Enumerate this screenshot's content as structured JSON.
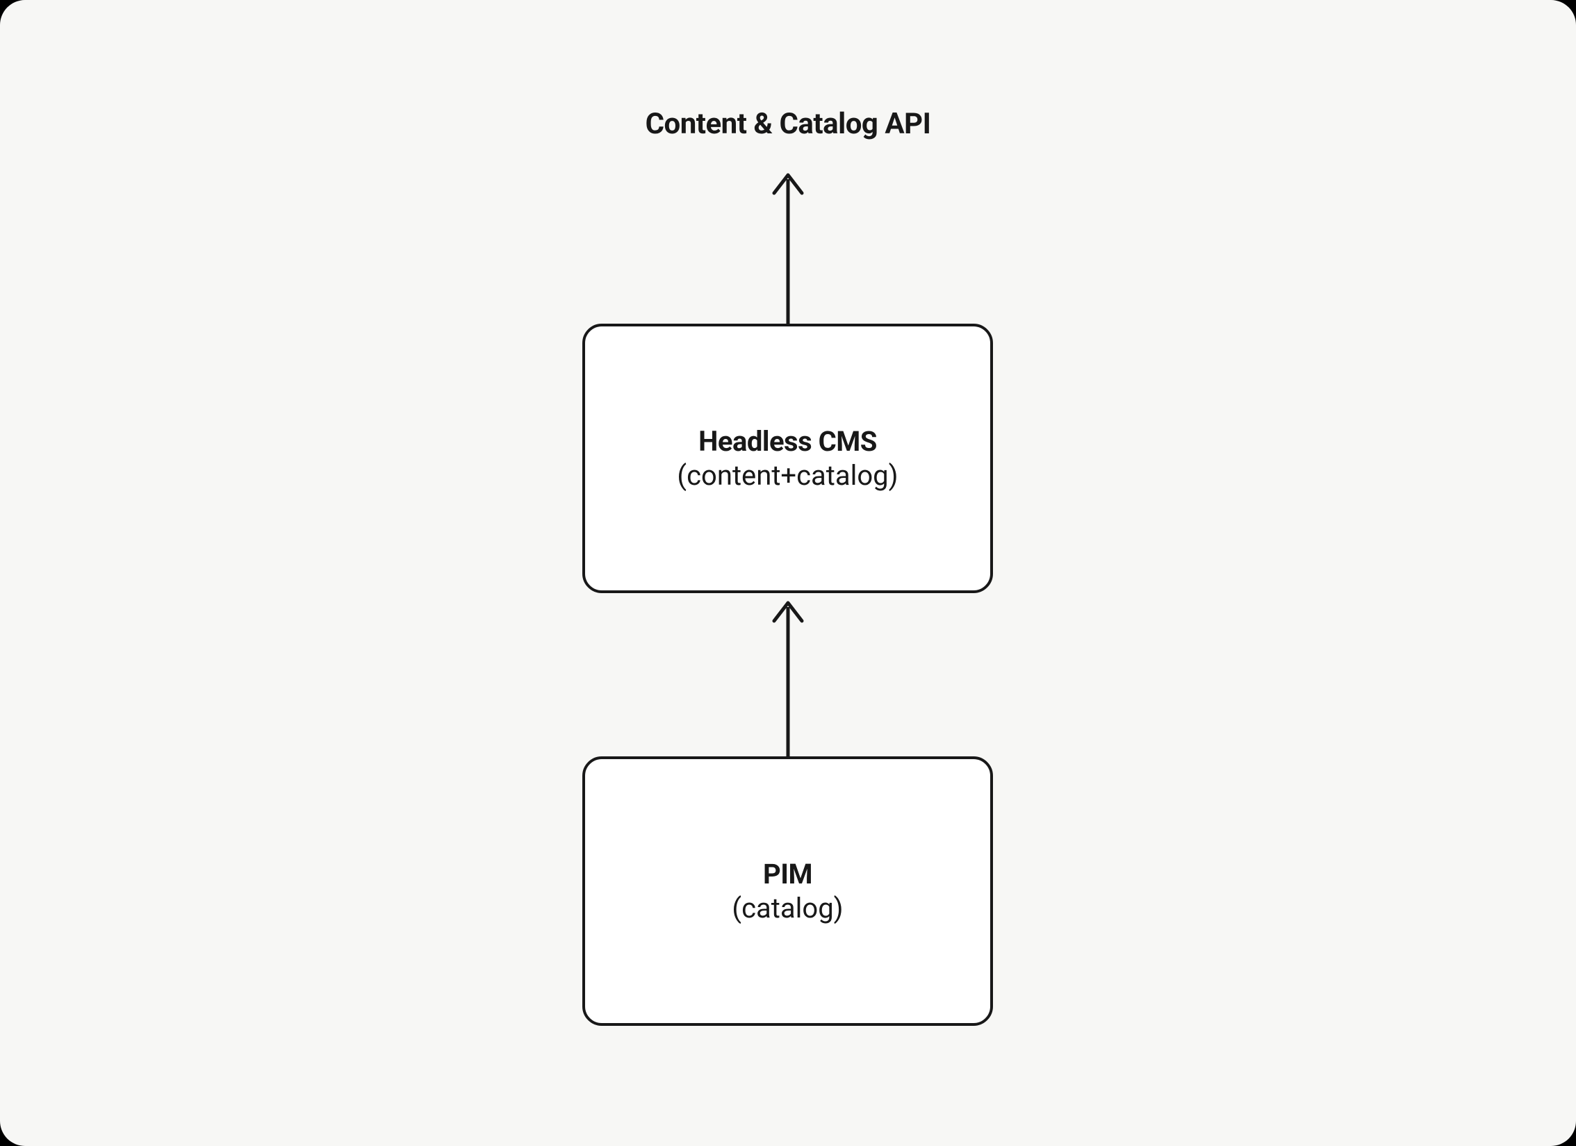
{
  "diagram": {
    "title": "Content & Catalog API",
    "nodes": {
      "cms": {
        "title": "Headless CMS",
        "subtitle": "(content+catalog)"
      },
      "pim": {
        "title": "PIM",
        "subtitle": "(catalog)"
      }
    }
  }
}
